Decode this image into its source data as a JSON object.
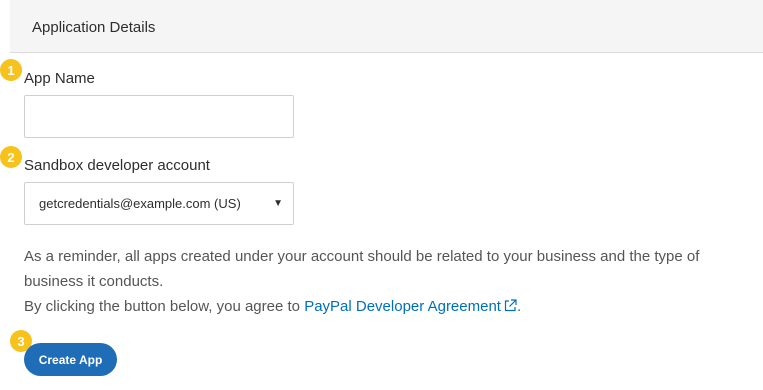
{
  "header": {
    "title": "Application Details"
  },
  "steps": [
    "1",
    "2",
    "3"
  ],
  "app_name": {
    "label": "App Name",
    "value": "",
    "placeholder": ""
  },
  "sandbox_account": {
    "label": "Sandbox developer account",
    "selected": "getcredentials@example.com (US)"
  },
  "notice": {
    "reminder": "As a reminder, all apps created under your account should be related to your business and the type of business it conducts.",
    "agree_prefix": "By clicking the button below, you agree to",
    "agreement_link": "PayPal Developer Agreement",
    "agree_suffix": "."
  },
  "actions": {
    "create_label": "Create App"
  },
  "colors": {
    "badge": "#f6c21b",
    "link": "#0070ba",
    "button": "#1f6db6"
  }
}
